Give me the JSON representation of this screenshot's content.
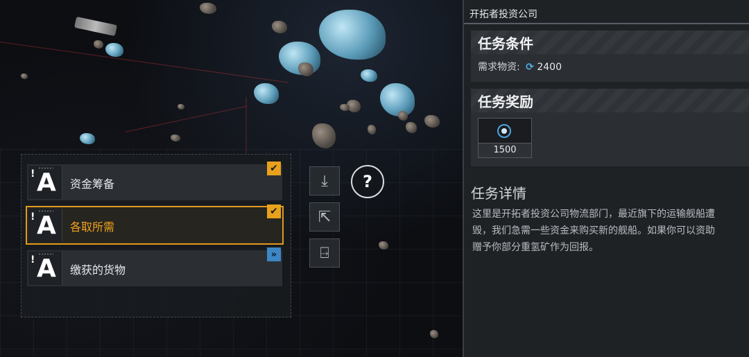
{
  "quests": [
    {
      "icon_letter": "A",
      "icon_mark": "!",
      "title": "资金筹备",
      "status_icon": "check-icon",
      "status_glyph": "✔"
    },
    {
      "icon_letter": "A",
      "icon_mark": "!",
      "title": "各取所需",
      "status_icon": "check-icon",
      "status_glyph": "✔"
    },
    {
      "icon_letter": "A",
      "icon_mark": "!",
      "title": "缴获的货物",
      "status_icon": "fast-forward-icon",
      "status_glyph": "»"
    }
  ],
  "side_buttons": [
    {
      "icon": "download-icon",
      "glyph": "⤓"
    },
    {
      "icon": "share-icon",
      "glyph": "⇱"
    },
    {
      "icon": "pin-icon",
      "glyph": "⍈"
    }
  ],
  "help": {
    "icon": "help-icon",
    "glyph": "?"
  },
  "panel": {
    "company": "开拓者投资公司",
    "conditions_title": "任务条件",
    "requirement_label": "需求物资:",
    "requirement_amount": "2400",
    "requirement_icon": "refresh-currency-icon",
    "rewards_title": "任务奖励",
    "reward_amount": "1500",
    "reward_icon": "crystal-icon",
    "details_title": "任务详情",
    "details_text": "这里是开拓者投资公司物流部门，最近旗下的运输舰船遭\n毁，我们急需一些资金来购买新的舰船。如果你可以资助\n赠予你部分重氢矿作为回报。"
  },
  "colors": {
    "accent": "#e7a11c",
    "blue": "#3d87c5",
    "currency": "#4fb0e6"
  }
}
